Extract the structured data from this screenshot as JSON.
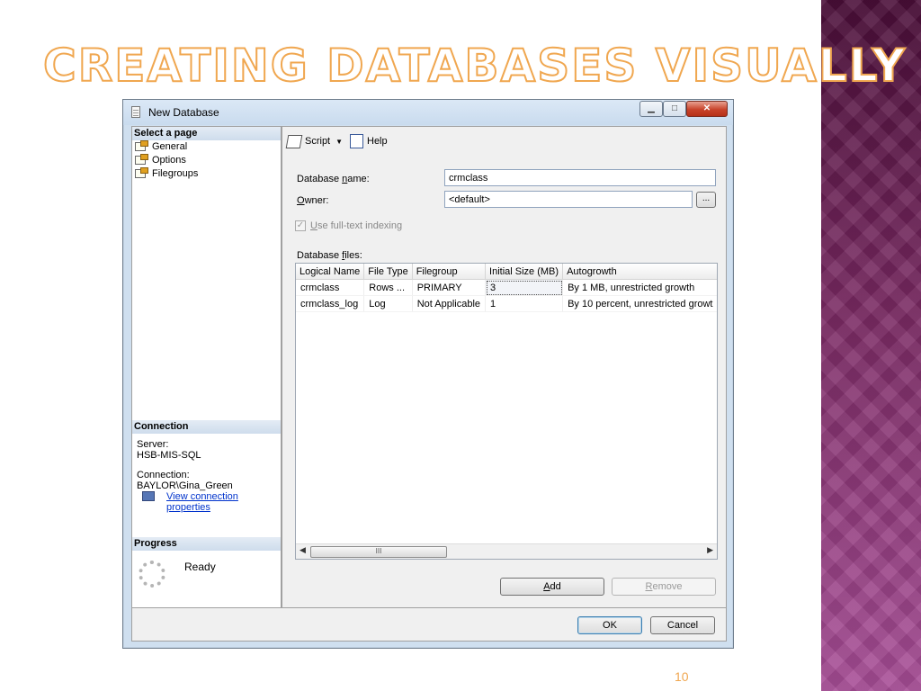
{
  "slide": {
    "title": "Creating Databases Visually",
    "page_number": "10"
  },
  "window": {
    "title": "New Database",
    "min_icon": "minimize-icon",
    "max_icon": "maximize-icon",
    "close_label": "✕"
  },
  "left_pane": {
    "select_page_header": "Select a page",
    "pages": [
      {
        "label": "General",
        "icon": "page-icon"
      },
      {
        "label": "Options",
        "icon": "page-icon"
      },
      {
        "label": "Filegroups",
        "icon": "page-icon"
      }
    ],
    "connection_header": "Connection",
    "server_label": "Server:",
    "server_value": "HSB-MIS-SQL",
    "connection_label": "Connection:",
    "connection_value": "BAYLOR\\Gina_Green",
    "view_connection_link": "View connection properties",
    "progress_header": "Progress",
    "progress_status": "Ready"
  },
  "toolbar": {
    "script_label": "Script",
    "help_label": "Help"
  },
  "form": {
    "database_name_label_prefix": "Database ",
    "database_name_label_accel": "n",
    "database_name_label_suffix": "ame:",
    "database_name_value": "crmclass",
    "owner_label_accel": "O",
    "owner_label_suffix": "wner:",
    "owner_value": "<default>",
    "browse_label": "...",
    "fulltext_checked": true,
    "fulltext_label_accel": "U",
    "fulltext_label_suffix": "se full-text indexing",
    "database_files_label_prefix": "Database ",
    "database_files_label_accel": "f",
    "database_files_label_suffix": "iles:"
  },
  "files_table": {
    "columns": [
      "Logical Name",
      "File Type",
      "Filegroup",
      "Initial Size (MB)",
      "Autogrowth"
    ],
    "rows": [
      [
        "crmclass",
        "Rows ...",
        "PRIMARY",
        "3",
        "By 1 MB, unrestricted growth"
      ],
      [
        "crmclass_log",
        "Log",
        "Not Applicable",
        "1",
        "By 10 percent, unrestricted growt"
      ]
    ],
    "scroll_thumb_label": "III"
  },
  "buttons": {
    "add_accel": "A",
    "add_suffix": "dd",
    "remove_accel": "R",
    "remove_suffix": "emove",
    "ok": "OK",
    "cancel": "Cancel"
  },
  "colors": {
    "title_stroke": "#f0a750",
    "side_band": "#7a2a63",
    "link": "#0033cc"
  }
}
